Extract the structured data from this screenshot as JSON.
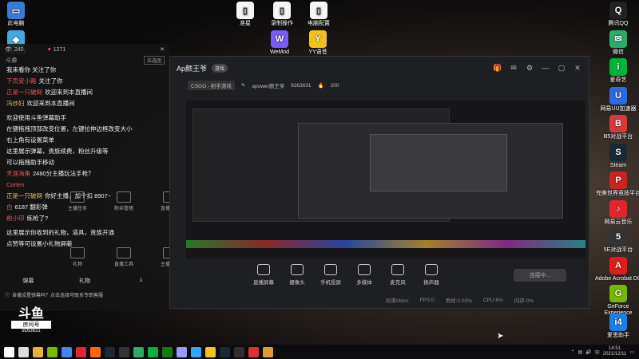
{
  "desktop_top_left": [
    {
      "label": "此电脑",
      "color": "#3a7bd5",
      "glyph": "▭"
    },
    {
      "label": "斗鱼助手",
      "color": "#3fa9e0",
      "glyph": "◆"
    }
  ],
  "desktop_top_center": [
    {
      "label": "准星",
      "color": "#f5f5f5",
      "glyph": "▯"
    },
    {
      "label": "录制操作",
      "color": "#f5f5f5",
      "glyph": "▯"
    },
    {
      "label": "电脑配置",
      "color": "#f5f5f5",
      "glyph": "▯"
    },
    {
      "label": "WeMod",
      "color": "#7a5af8",
      "glyph": "W"
    },
    {
      "label": "YY语音",
      "color": "#f2c21b",
      "glyph": "Y"
    }
  ],
  "desktop_right": [
    {
      "label": "腾讯QQ",
      "color": "#222",
      "glyph": "Q"
    },
    {
      "label": "微信",
      "color": "#2aae67",
      "glyph": "✉"
    },
    {
      "label": "爱奇艺",
      "color": "#00b33c",
      "glyph": "i"
    },
    {
      "label": "网易UU加速器",
      "color": "#2a6be0",
      "glyph": "U"
    },
    {
      "label": "B5对战平台",
      "color": "#d83a3a",
      "glyph": "B"
    },
    {
      "label": "Steam",
      "color": "#1b2838",
      "glyph": "S"
    },
    {
      "label": "完美世界竞技平台",
      "color": "#c22",
      "glyph": "P"
    },
    {
      "label": "网易云音乐",
      "color": "#e0262d",
      "glyph": "♪"
    },
    {
      "label": "5E对战平台",
      "color": "#333",
      "glyph": "5"
    },
    {
      "label": "Adobe Acrobat DC",
      "color": "#e21b1b",
      "glyph": "A"
    },
    {
      "label": "GeForce Experience",
      "color": "#76b900",
      "glyph": "G"
    },
    {
      "label": "爱思助手",
      "color": "#1a7fe6",
      "glyph": "i4"
    }
  ],
  "chat": {
    "stats": {
      "viewers": "240",
      "likes": "1271"
    },
    "header_label": "拉选团",
    "lines": [
      {
        "user": "",
        "text": "我来看你 关注了你"
      },
      {
        "user": "下页安小路",
        "text": "关注了你"
      },
      {
        "user": "正是一只破网",
        "text": "欢迎来到本直播间"
      },
      {
        "user": "冯炒妇",
        "text": "欢迎来到本直播间"
      },
      {
        "user": "",
        "text": ""
      },
      {
        "user": "",
        "text": "欢迎使用斗鱼弹幕助手"
      },
      {
        "user": "",
        "text": "在键拖拽顶部改变位置，左键拉伸边框改变大小"
      },
      {
        "user": "",
        "text": "右上角有设置菜单"
      },
      {
        "user": "",
        "text": "这里展示弹幕，贵族续费，粉丝升级等"
      },
      {
        "user": "",
        "text": "可以拖拽助手移动"
      },
      {
        "user": "天涯海角",
        "text": "2480分主播玩法手枪？"
      },
      {
        "user": "Corten",
        "text": ""
      },
      {
        "user": "正是一只破网",
        "text": "你好主播，加个扣 8907~"
      },
      {
        "user": "白",
        "text": "6187 翻彩弹"
      },
      {
        "user": "前小印",
        "text": "练枪了?"
      },
      {
        "user": "",
        "text": ""
      },
      {
        "user": "",
        "text": "这里展示你收到的礼物，道具，贵族开通"
      },
      {
        "user": "",
        "text": "点赞等可设置小礼物屏蔽"
      }
    ],
    "tiles_row1": [
      "主播任务",
      "粉丝管理",
      "直播回放"
    ],
    "tiles_row2": [
      "礼物",
      "直播工具",
      "主播活动"
    ],
    "bottom_tabs": [
      "弹幕",
      "礼物",
      ""
    ],
    "footer_hint": "自播设置弹幕吗？点击选择可联系专职客服"
  },
  "window": {
    "room_title": "Ap颜王爷",
    "tag": "游戏",
    "breadcrumb": "CSGO - 射手游戏",
    "anchor": "apower颜王爷",
    "room_id": "9263631",
    "online": "200",
    "toolbar": [
      "直播屏幕",
      "摄像头",
      "手机投屏",
      "多媒体",
      "麦克风",
      "扬声器"
    ],
    "start_button": "连接中...",
    "status": [
      "码率0kb/s",
      "FPS:0",
      "丢帧:0.00%",
      "CPU:6%",
      "内存:0%"
    ]
  },
  "taskbar": {
    "time": "14:51",
    "date": "2021/12/11",
    "apps": [
      {
        "name": "start",
        "color": "#fff"
      },
      {
        "name": "search",
        "color": "#ddd"
      },
      {
        "name": "folder",
        "color": "#e6b43c"
      },
      {
        "name": "nvidia",
        "color": "#76b900"
      },
      {
        "name": "chrome",
        "color": "#4285f4"
      },
      {
        "name": "netease-music",
        "color": "#e0262d"
      },
      {
        "name": "douyu",
        "color": "#ff6a00"
      },
      {
        "name": "steam",
        "color": "#1b2838"
      },
      {
        "name": "qq",
        "color": "#333"
      },
      {
        "name": "wechat",
        "color": "#2aae67"
      },
      {
        "name": "iqiyi",
        "color": "#00b33c"
      },
      {
        "name": "xbox",
        "color": "#107c10"
      },
      {
        "name": "premiere",
        "color": "#9999ff"
      },
      {
        "name": "photoshop",
        "color": "#31a8ff"
      },
      {
        "name": "yy",
        "color": "#f2c21b"
      },
      {
        "name": "steam2",
        "color": "#1b2838"
      },
      {
        "name": "obs",
        "color": "#302e31"
      },
      {
        "name": "red-app",
        "color": "#d33"
      },
      {
        "name": "csgo",
        "color": "#de9b35"
      }
    ]
  },
  "douyu_logo": {
    "line1": "斗鱼",
    "line2": "房间号",
    "line3": "9263631"
  }
}
